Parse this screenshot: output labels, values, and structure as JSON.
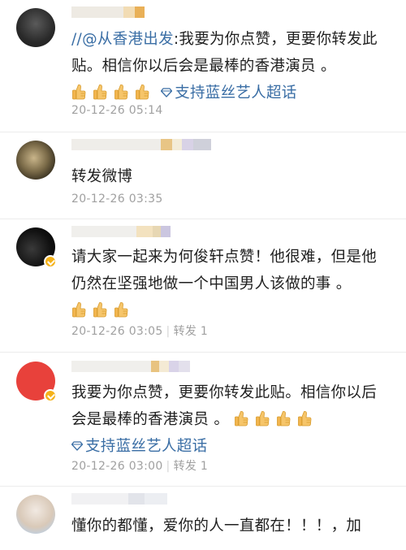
{
  "comments": [
    {
      "mention": "//@从香港出发",
      "text": ":我要为你点赞，更要你转发此贴。相信你以后会是最棒的香港演员 。",
      "thumbs_count": 4,
      "topic": "支持蓝丝艺人超话",
      "time": "20-12-26 05:14"
    },
    {
      "text": "转发微博",
      "time": "20-12-26 03:35"
    },
    {
      "text": "请大家一起来为何俊轩点赞！他很难，但是他仍然在坚强地做一个中国男人该做的事 。",
      "thumbs_count": 3,
      "time": "20-12-26 03:05",
      "repost": "转发 1"
    },
    {
      "text": "我要为你点赞，更要你转发此贴。相信你以后会是最棒的香港演员 。",
      "thumbs_count": 4,
      "topic": "支持蓝丝艺人超话",
      "time": "20-12-26 03:00",
      "repost": "转发 1"
    },
    {
      "text": "懂你的都懂，爱你的人一直都在！！！，加"
    }
  ],
  "colors": {
    "link": "#3a6ea5",
    "meta": "#a0a0a0",
    "verified_badge": "#f5b21a"
  }
}
